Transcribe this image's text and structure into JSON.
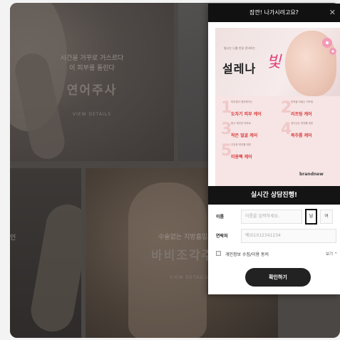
{
  "background": {
    "tile1": {
      "line1": "시간을 거꾸로 거스르다",
      "line2": "이 피부를 돌린다",
      "title": "연어주사",
      "link": "VIEW DETAILS"
    },
    "tile_left": {
      "text": "인"
    },
    "tile_body": {
      "line1": "수술없는 지방흡입효과",
      "title": "바비조각주사",
      "link": "VIEW DETAILS"
    }
  },
  "modal": {
    "header": "잠깐! 나가시려고요?",
    "close_icon": "close-icon",
    "banner": {
      "subtitle": "빛나는 나를 만날 준비하는",
      "title": "설레나",
      "title_accent": "빛",
      "steps": [
        {
          "num": "1",
          "small": "피부결이 매끈해지는",
          "label": "도자기 피부 케어"
        },
        {
          "num": "2",
          "small": "탄력을 되찾는 리프팅",
          "label": "리프팅 케어"
        },
        {
          "num": "3",
          "small": "맑고 깨끗한 피부로",
          "label": "작은 얼굴 케어"
        },
        {
          "num": "4",
          "small": "생기있는 피부를 위한",
          "label": "복주름 케어"
        },
        {
          "num": "5",
          "small": "건강한 피부를 위한",
          "label": "미용팩 케어"
        }
      ],
      "brand": "brandnew"
    },
    "live_bar": "실시간 상담진행!",
    "form": {
      "name_label": "이름",
      "name_placeholder": "이름을 입력하세요.",
      "gender_male": "남",
      "gender_female": "여",
      "phone_label": "연락처",
      "phone_placeholder": "예)01012341234",
      "consent_label": "개인정보 수집/이용 동의",
      "consent_more": "보기 ^",
      "submit": "확인하기"
    }
  }
}
